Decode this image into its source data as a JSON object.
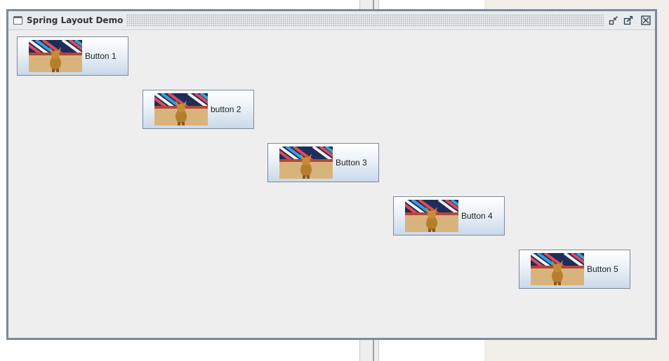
{
  "window": {
    "title": "Spring Layout Demo",
    "controls": {
      "iconify_icon": "iconify-icon",
      "maximize_icon": "maximize-icon",
      "close_icon": "close-icon"
    }
  },
  "buttons": [
    {
      "label": "Button 1",
      "image": "photo-thumbnail"
    },
    {
      "label": "button 2",
      "image": "photo-thumbnail"
    },
    {
      "label": "Button 3",
      "image": "photo-thumbnail"
    },
    {
      "label": "Button 4",
      "image": "photo-thumbnail"
    },
    {
      "label": "Button 5",
      "image": "photo-thumbnail"
    }
  ],
  "colors": {
    "frame_border": "#7d8a99",
    "content_bg": "#eeeeee",
    "button_gradient_top": "#ffffff",
    "button_gradient_bottom": "#c9d9ea"
  }
}
